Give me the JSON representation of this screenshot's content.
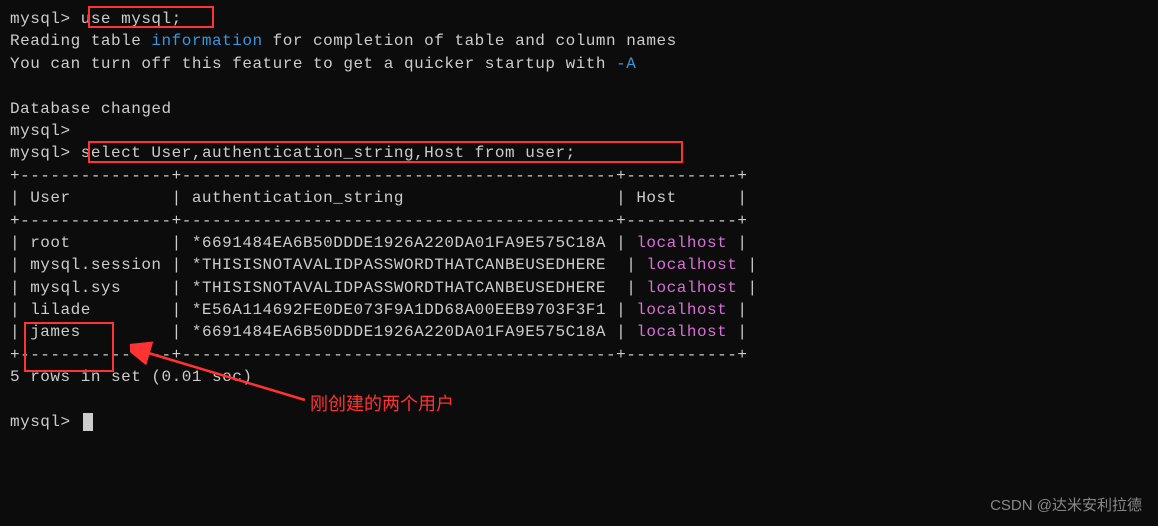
{
  "prompt": "mysql>",
  "cmd1": "use mysql;",
  "line_reading": "Reading table ",
  "info_link": "information",
  "line_reading2": " for completion of table and column names",
  "line_turnoff": "You can turn off this feature to get a quicker startup with ",
  "flag_a": "-A",
  "db_changed": "Database changed",
  "cmd2": "select User,authentication_string,Host from user;",
  "table": {
    "border": "+---------------+-------------------------------------------+-----------+",
    "header_user": "User",
    "header_auth": "authentication_string",
    "header_host": "Host",
    "rows": [
      {
        "user": "root",
        "auth": "*6691484EA6B50DDDE1926A220DA01FA9E575C18A",
        "host": "localhost"
      },
      {
        "user": "mysql.session",
        "auth": "*THISISNOTAVALIDPASSWORDTHATCANBEUSEDHERE",
        "host": "localhost"
      },
      {
        "user": "mysql.sys",
        "auth": "*THISISNOTAVALIDPASSWORDTHATCANBEUSEDHERE",
        "host": "localhost"
      },
      {
        "user": "lilade",
        "auth": "*E56A114692FE0DE073F9A1DD68A00EEB9703F3F1",
        "host": "localhost"
      },
      {
        "user": "james",
        "auth": "*6691484EA6B50DDDE1926A220DA01FA9E575C18A",
        "host": "localhost"
      }
    ]
  },
  "result_summary": "5 rows in set (0.01 sec)",
  "annotation": "刚创建的两个用户",
  "watermark": "CSDN @达米安利拉德",
  "chart_data": {
    "type": "table",
    "title": "MySQL user table query result",
    "columns": [
      "User",
      "authentication_string",
      "Host"
    ],
    "rows": [
      [
        "root",
        "*6691484EA6B50DDDE1926A220DA01FA9E575C18A",
        "localhost"
      ],
      [
        "mysql.session",
        "*THISISNOTAVALIDPASSWORDTHATCANBEUSEDHERE",
        "localhost"
      ],
      [
        "mysql.sys",
        "*THISISNOTAVALIDPASSWORDTHATCANBEUSEDHERE",
        "localhost"
      ],
      [
        "lilade",
        "*E56A114692FE0DE073F9A1DD68A00EEB9703F3F1",
        "localhost"
      ],
      [
        "james",
        "*6691484EA6B50DDDE1926A220DA01FA9E575C18A",
        "localhost"
      ]
    ]
  }
}
